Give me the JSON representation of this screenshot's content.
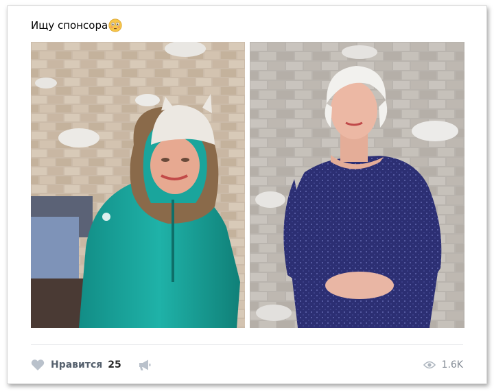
{
  "post": {
    "text": "Ищу спонсора",
    "emoji": "flushed-face-emoji"
  },
  "photos": [
    {
      "description_icon": "photo-woman-in-teal-winter-jacket"
    },
    {
      "description_icon": "photo-woman-in-navy-sequin-dress"
    }
  ],
  "actions": {
    "like_label": "Нравится",
    "like_count": "25",
    "like_icon": "heart-icon",
    "share_icon": "megaphone-icon",
    "views_icon": "eye-icon",
    "views_count": "1.6K"
  },
  "colors": {
    "action_gray": "#828a94",
    "like_gray": "#55606d",
    "divider": "#e7e8ec",
    "teal_jacket": "#1aa59c",
    "navy_dress": "#2c2f73"
  }
}
